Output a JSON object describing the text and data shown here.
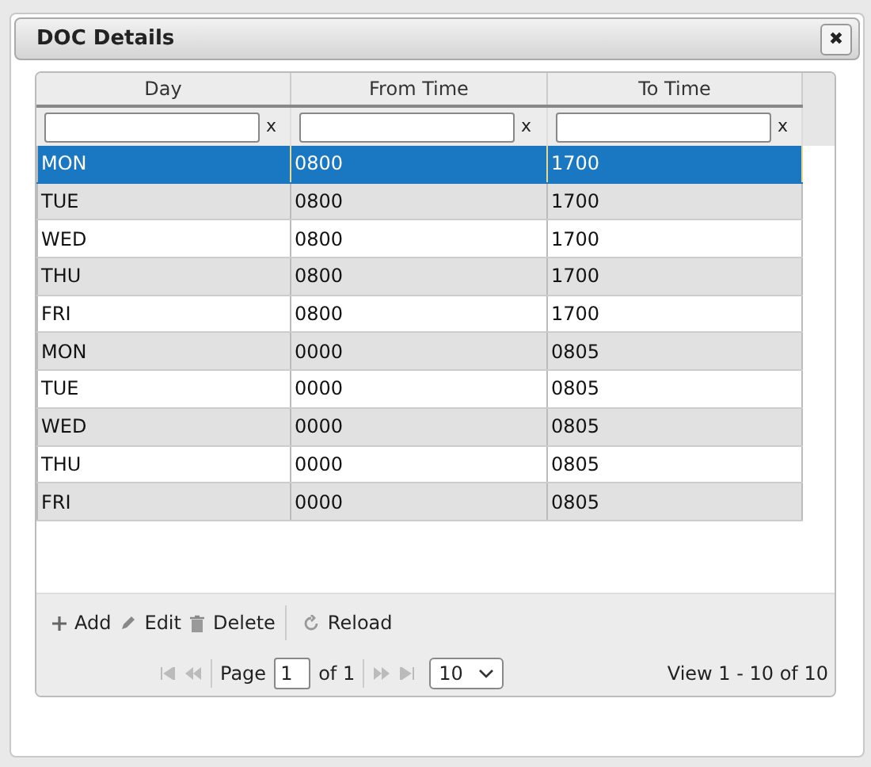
{
  "dialog": {
    "title": "DOC Details",
    "close": "✖"
  },
  "grid": {
    "columns": [
      "Day",
      "From Time",
      "To Time"
    ],
    "filter_clear": [
      "x",
      "x",
      "x"
    ],
    "rows": [
      {
        "cells": [
          "MON",
          "0800",
          "1700"
        ],
        "selected": true
      },
      {
        "cells": [
          "TUE",
          "0800",
          "1700"
        ],
        "selected": false
      },
      {
        "cells": [
          "WED",
          "0800",
          "1700"
        ],
        "selected": false
      },
      {
        "cells": [
          "THU",
          "0800",
          "1700"
        ],
        "selected": false
      },
      {
        "cells": [
          "FRI",
          "0800",
          "1700"
        ],
        "selected": false
      },
      {
        "cells": [
          "MON",
          "0000",
          "0805"
        ],
        "selected": false
      },
      {
        "cells": [
          "TUE",
          "0000",
          "0805"
        ],
        "selected": false
      },
      {
        "cells": [
          "WED",
          "0000",
          "0805"
        ],
        "selected": false
      },
      {
        "cells": [
          "THU",
          "0000",
          "0805"
        ],
        "selected": false
      },
      {
        "cells": [
          "FRI",
          "0000",
          "0805"
        ],
        "selected": false
      }
    ]
  },
  "toolbar": [
    {
      "kind": "add",
      "label": "Add"
    },
    {
      "kind": "edit",
      "label": "Edit"
    },
    {
      "kind": "delete",
      "label": "Delete"
    },
    {
      "kind": "reload",
      "label": "Reload"
    }
  ],
  "pager": {
    "page_label": "Page",
    "page": "1",
    "of": "of 1",
    "page_size": "10",
    "view": "View 1 - 10 of 10"
  }
}
